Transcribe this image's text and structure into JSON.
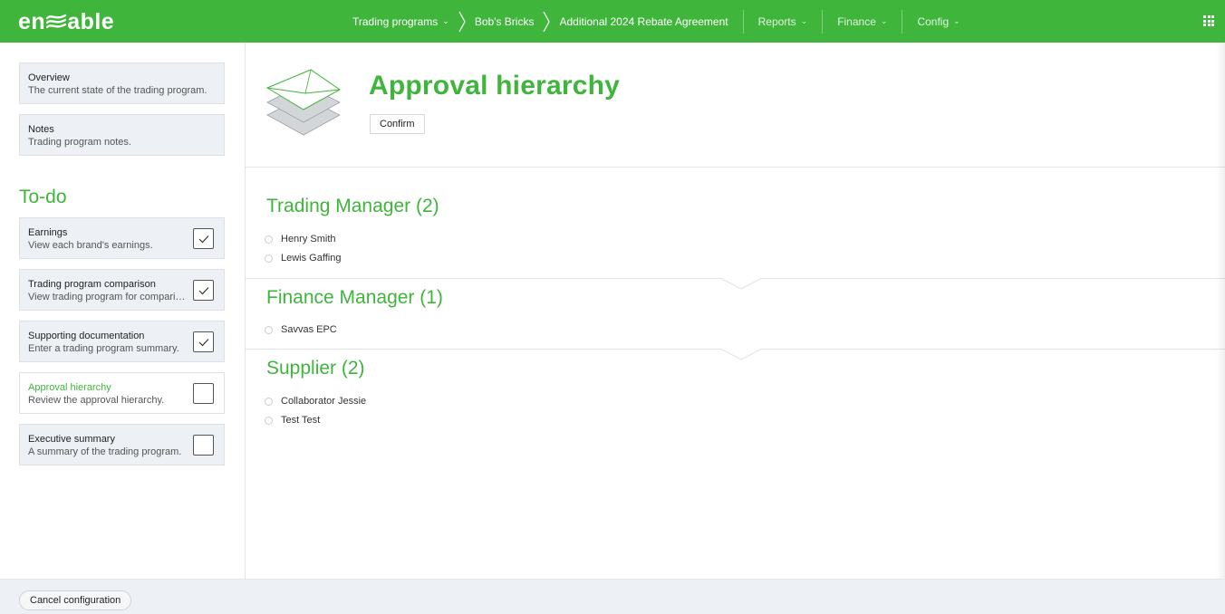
{
  "brand": {
    "logo_left": "en",
    "logo_right": "able",
    "accent": "#3fb53b"
  },
  "nav": {
    "breadcrumbs": [
      {
        "label": "Trading programs",
        "has_caret": true
      },
      {
        "label": "Bob's Bricks"
      },
      {
        "label": "Additional 2024 Rebate Agreement"
      }
    ],
    "menus": [
      {
        "label": "Reports"
      },
      {
        "label": "Finance"
      },
      {
        "label": "Config"
      }
    ],
    "apps_icon": "grid-icon"
  },
  "sidebar": {
    "top_cards": [
      {
        "title": "Overview",
        "subtitle": "The current state of the trading program."
      },
      {
        "title": "Notes",
        "subtitle": "Trading program notes."
      }
    ],
    "todo_heading": "To-do",
    "todo_items": [
      {
        "title": "Earnings",
        "subtitle": "View each brand's earnings.",
        "checked": true
      },
      {
        "title": "Trading program comparison",
        "subtitle": "View trading program for comparison.",
        "checked": true
      },
      {
        "title": "Supporting documentation",
        "subtitle": "Enter a trading program summary.",
        "checked": true
      },
      {
        "title": "Approval hierarchy",
        "subtitle": "Review the approval hierarchy.",
        "checked": false,
        "active": true
      },
      {
        "title": "Executive summary",
        "subtitle": "A summary of the trading program.",
        "checked": false
      }
    ]
  },
  "main": {
    "title": "Approval hierarchy",
    "confirm_label": "Confirm",
    "header_icon": "envelope-stack-icon",
    "sections": [
      {
        "heading": "Trading Manager (2)",
        "people": [
          "Henry Smith",
          "Lewis Gaffing"
        ]
      },
      {
        "heading": "Finance Manager (1)",
        "people": [
          "Savvas EPC"
        ]
      },
      {
        "heading": "Supplier (2)",
        "people": [
          "Collaborator Jessie",
          "Test Test"
        ]
      }
    ]
  },
  "footer": {
    "cancel_label": "Cancel configuration"
  }
}
